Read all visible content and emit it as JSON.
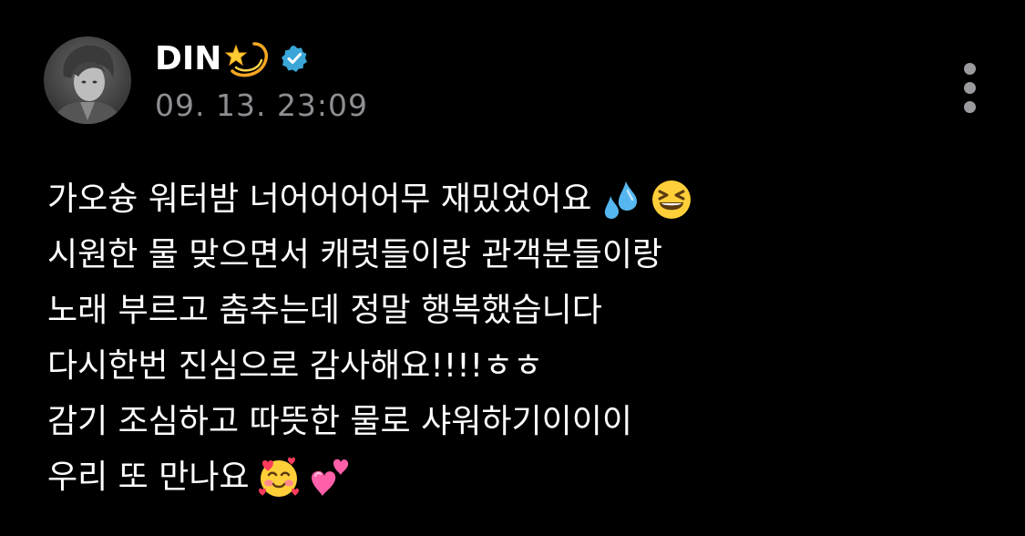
{
  "post": {
    "author": {
      "name": "DIN",
      "name_emoji": "dizzy-star-emoji",
      "verified": true
    },
    "timestamp": "09. 13. 23:09",
    "more_menu_icon": "more-vertical-icon",
    "lines": [
      {
        "text": "가오슝 워터밤 너어어어어무 재밌었어요",
        "emojis": [
          "sweat-droplets-emoji",
          "grinning-squinting-face-emoji"
        ]
      },
      {
        "text": "시원한 물 맞으면서 캐럿들이랑 관객분들이랑",
        "emojis": []
      },
      {
        "text": "노래 부르고 춤추는데 정말 행복했습니다",
        "emojis": []
      },
      {
        "text": "다시한번 진심으로 감사해요!!!!ㅎㅎ",
        "emojis": []
      },
      {
        "text": "감기 조심하고 따뜻한 물로 샤워하기이이이",
        "emojis": []
      },
      {
        "text": "우리 또 만나요",
        "emojis": [
          "smiling-face-with-hearts-emoji",
          "two-hearts-emoji"
        ]
      }
    ]
  },
  "colors": {
    "background": "#000000",
    "text": "#ffffff",
    "timestamp": "#8e8e93",
    "verified_badge": "#3aa6d8",
    "more_dots": "#9a9a9f"
  }
}
